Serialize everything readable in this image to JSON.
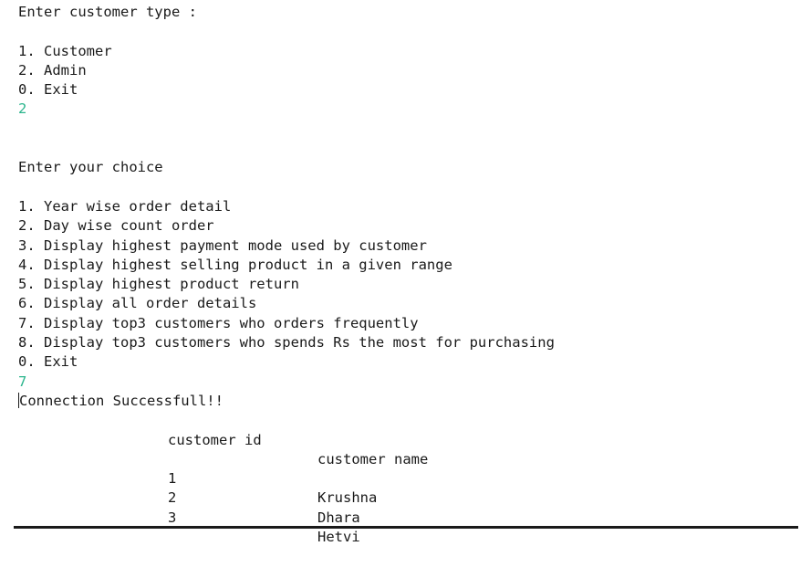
{
  "customer_type_menu": {
    "prompt": "Enter customer type :",
    "options": [
      "1. Customer",
      "2. Admin",
      "0. Exit"
    ],
    "input": "2"
  },
  "admin_menu": {
    "prompt": "Enter your choice",
    "options": [
      "1. Year wise order detail",
      "2. Day wise count order",
      "3. Display highest payment mode used by customer",
      "4. Display highest selling product in a given range",
      "5. Display highest product return",
      "6. Display all order details",
      "7. Display top3 customers who orders frequently",
      "8. Display top3 customers who spends Rs the most for purchasing",
      "0. Exit"
    ],
    "input": "7"
  },
  "result": {
    "status": "Connection Successfull!!",
    "headers": {
      "id": "customer id",
      "name": "customer name"
    },
    "rows": [
      {
        "id": "1",
        "name": "Krushna"
      },
      {
        "id": "2",
        "name": "Dhara"
      },
      {
        "id": "3",
        "name": "Hetvi"
      }
    ]
  }
}
